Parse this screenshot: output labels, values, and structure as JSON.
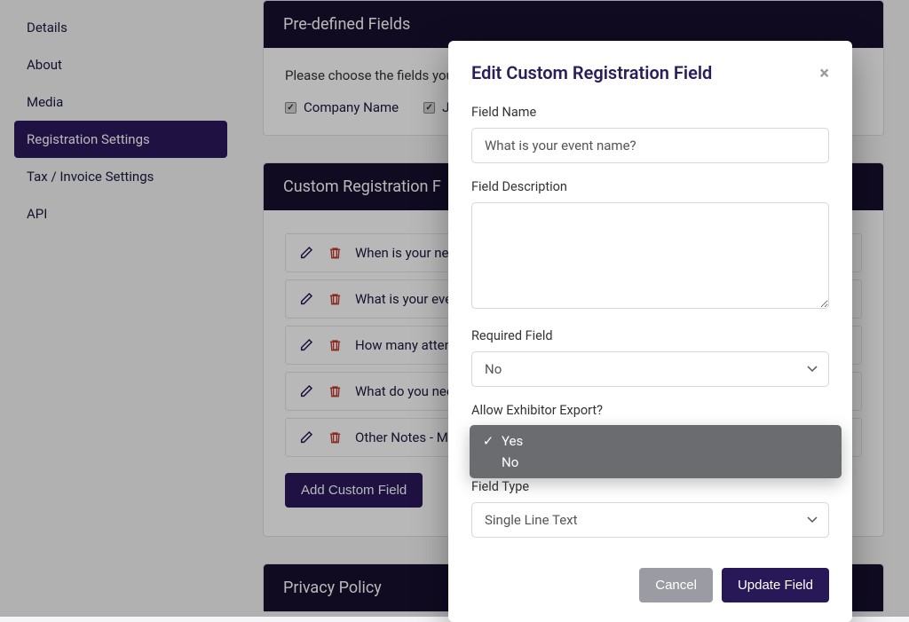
{
  "sidebar": {
    "items": [
      {
        "label": "Details"
      },
      {
        "label": "About"
      },
      {
        "label": "Media"
      },
      {
        "label": "Registration Settings"
      },
      {
        "label": "Tax / Invoice Settings"
      },
      {
        "label": "API"
      }
    ]
  },
  "panels": {
    "predefined": {
      "title": "Pre-defined Fields",
      "intro": "Please choose the fields you",
      "checkboxes": {
        "company": "Company Name",
        "job": "Jo"
      }
    },
    "custom": {
      "title": "Custom Registration F",
      "rows": [
        "When is your nex",
        "What is your eve",
        "How many attend",
        "What do you nee",
        "Other Notes - Mu"
      ],
      "add_button": "Add Custom Field"
    },
    "privacy": {
      "title": "Privacy Policy"
    }
  },
  "modal": {
    "title": "Edit Custom Registration Field",
    "labels": {
      "field_name": "Field Name",
      "field_description": "Field Description",
      "required": "Required Field",
      "allow_export": "Allow Exhibitor Export?",
      "field_type": "Field Type"
    },
    "values": {
      "field_name": "What is your event name?",
      "required": "No",
      "allow_export_selected": "Yes",
      "field_type": "Single Line Text"
    },
    "dropdown_options": {
      "yes": "Yes",
      "no": "No"
    },
    "buttons": {
      "cancel": "Cancel",
      "update": "Update Field"
    }
  }
}
